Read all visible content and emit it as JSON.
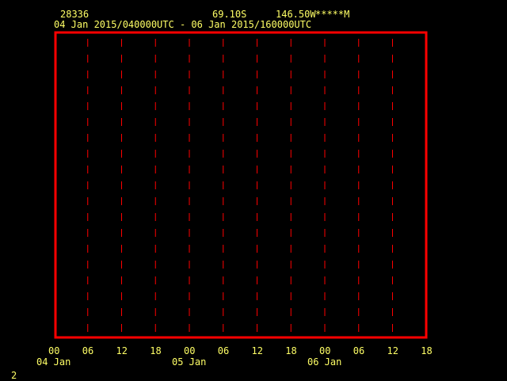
{
  "header": {
    "station_id": "28336",
    "lat": "69.10S",
    "lon": "146.50W",
    "elev": "*****M",
    "time_range": "04 Jan 2015/040000UTC - 06 Jan 2015/160000UTC"
  },
  "footer": {
    "page_number": "2"
  },
  "colors": {
    "background": "#000000",
    "text": "#ffff66",
    "frame": "#ff0000",
    "gridline": "#ff0000"
  },
  "chart_data": {
    "type": "line",
    "series": [],
    "grid": true,
    "gridline_style": "dashed-vertical",
    "x_ticks": [
      "00",
      "06",
      "12",
      "18",
      "00",
      "06",
      "12",
      "18",
      "00",
      "06",
      "12",
      "18"
    ],
    "day_labels": [
      {
        "tick_index": 0,
        "label": "04 Jan"
      },
      {
        "tick_index": 4,
        "label": "05 Jan"
      },
      {
        "tick_index": 8,
        "label": "06 Jan"
      }
    ]
  }
}
